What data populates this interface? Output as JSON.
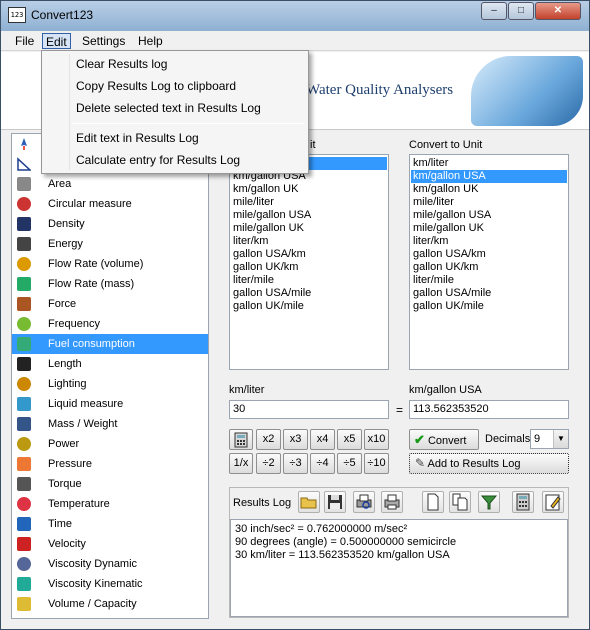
{
  "window": {
    "title": "Convert123",
    "icon_text": "123",
    "minimize": "–",
    "maximize": "□",
    "close": "✕"
  },
  "menu": {
    "items": [
      "File",
      "Edit",
      "Settings",
      "Help"
    ],
    "active": "Edit"
  },
  "edit_menu": {
    "items": [
      "Clear Results log",
      "Copy Results Log to clipboard",
      "Delete selected text in Results Log"
    ],
    "items2": [
      "Edit text in Results Log",
      "Calculate entry for Results Log"
    ]
  },
  "banner": {
    "text": "Water Quality Analysers"
  },
  "categories": [
    {
      "label": "Area",
      "icon": "area-grid-icon"
    },
    {
      "label": "Circular measure",
      "icon": "circle-icon"
    },
    {
      "label": "Density",
      "icon": "density-icon"
    },
    {
      "label": "Energy",
      "icon": "battery-icon"
    },
    {
      "label": "Flow Rate (volume)",
      "icon": "flow-volume-icon"
    },
    {
      "label": "Flow Rate (mass)",
      "icon": "flow-mass-icon"
    },
    {
      "label": "Force",
      "icon": "force-icon"
    },
    {
      "label": "Frequency",
      "icon": "wave-icon"
    },
    {
      "label": "Fuel consumption",
      "icon": "fuel-pump-icon"
    },
    {
      "label": "Length",
      "icon": "ruler-icon"
    },
    {
      "label": "Lighting",
      "icon": "lamp-icon"
    },
    {
      "label": "Liquid measure",
      "icon": "barrel-icon"
    },
    {
      "label": "Mass / Weight",
      "icon": "dumbbell-icon"
    },
    {
      "label": "Power",
      "icon": "power-icon"
    },
    {
      "label": "Pressure",
      "icon": "gauge-icon"
    },
    {
      "label": "Torque",
      "icon": "wrench-icon"
    },
    {
      "label": "Temperature",
      "icon": "thermometer-icon"
    },
    {
      "label": "Time",
      "icon": "clock-icon"
    },
    {
      "label": "Velocity",
      "icon": "car-icon"
    },
    {
      "label": "Viscosity Dynamic",
      "icon": "viscosity-dynamic-icon"
    },
    {
      "label": "Viscosity Kinematic",
      "icon": "funnel-icon"
    },
    {
      "label": "Volume / Capacity",
      "icon": "cube-icon"
    }
  ],
  "selected_category": "Fuel consumption",
  "from_unit": {
    "label_tail": "it",
    "items": [
      "km/liter",
      "km/gallon USA",
      "km/gallon UK",
      "mile/liter",
      "mile/gallon USA",
      "mile/gallon UK",
      "liter/km",
      "gallon USA/km",
      "gallon UK/km",
      "liter/mile",
      "gallon USA/mile",
      "gallon UK/mile"
    ],
    "selected": "km/liter"
  },
  "to_unit": {
    "label": "Convert to Unit",
    "items": [
      "km/liter",
      "km/gallon USA",
      "km/gallon UK",
      "mile/liter",
      "mile/gallon USA",
      "mile/gallon UK",
      "liter/km",
      "gallon USA/km",
      "gallon UK/km",
      "liter/mile",
      "gallon USA/mile",
      "gallon UK/mile"
    ],
    "selected": "km/gallon USA"
  },
  "conversion": {
    "from_label": "km/liter",
    "to_label": "km/gallon USA",
    "input_value": "30",
    "equals": "=",
    "output_value": "113.562353520"
  },
  "keypad": {
    "row1": [
      "x2",
      "x3",
      "x4",
      "x5",
      "x10"
    ],
    "row2": [
      "1/x",
      "÷2",
      "÷3",
      "÷4",
      "÷5",
      "÷10"
    ]
  },
  "actions": {
    "convert": "Convert",
    "decimals_label": "Decimals",
    "decimals_value": "9",
    "add_to_log": "Add to Results Log"
  },
  "results_log": {
    "label": "Results Log",
    "lines": [
      "30 inch/sec² = 0.762000000 m/sec²",
      "90 degrees (angle) = 0.500000000 semicircle",
      "30 km/liter = 113.562353520 km/gallon USA"
    ]
  }
}
